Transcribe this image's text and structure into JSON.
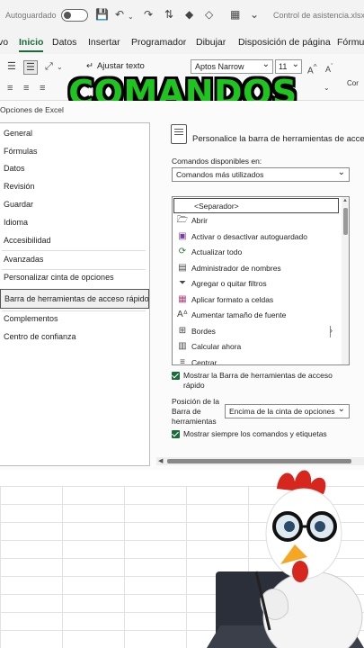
{
  "titlebar": {
    "autosave_label": "Autoguardado",
    "document_title": "Control de asistencia.xlsx"
  },
  "menu": {
    "items": [
      "vo",
      "Inicio",
      "Datos",
      "Insertar",
      "Programador",
      "Dibujar",
      "Disposición de página",
      "Fórmul"
    ],
    "active": "Inicio"
  },
  "ribbon": {
    "wrap_text": "Ajustar texto",
    "font_name": "Aptos Narrow",
    "font_size": "11",
    "side_label": "Cor"
  },
  "overlay_title": "COMANDOS",
  "dialog": {
    "title": "Opciones de Excel",
    "nav": [
      "General",
      "Fórmulas",
      "Datos",
      "Revisión",
      "Guardar",
      "Idioma",
      "Accesibilidad",
      "Avanzadas",
      "Personalizar cinta de opciones",
      "Barra de herramientas de acceso rápido",
      "Complementos",
      "Centro de confianza"
    ],
    "selected_nav": "Barra de herramientas de acceso rápido",
    "heading": "Personalice la barra de herramientas de acceso",
    "commands_from_label": "Comandos disponibles en:",
    "commands_from_value": "Comandos más utilizados",
    "commands": [
      {
        "icon": "separator-icon",
        "label": "<Separador>"
      },
      {
        "icon": "open-folder-icon",
        "label": "Abrir"
      },
      {
        "icon": "autosave-icon",
        "label": "Activar o desactivar autoguardado"
      },
      {
        "icon": "refresh-all-icon",
        "label": "Actualizar todo"
      },
      {
        "icon": "name-manager-icon",
        "label": "Administrador de nombres"
      },
      {
        "icon": "filter-icon",
        "label": "Agregar o quitar filtros"
      },
      {
        "icon": "format-cells-icon",
        "label": "Aplicar formato a celdas"
      },
      {
        "icon": "font-size-up-icon",
        "label": "Aumentar tamaño de fuente"
      },
      {
        "icon": "borders-icon",
        "label": "Bordes"
      },
      {
        "icon": "calculator-icon",
        "label": "Calcular ahora"
      },
      {
        "icon": "center-icon",
        "label": "Centrar"
      }
    ],
    "show_qat_label": "Mostrar la Barra de herramientas de acceso rápido",
    "show_qat_checked": true,
    "position_label": "Posición de la Barra de herramientas",
    "position_value": "Encima de la cinta de opciones",
    "always_show_label": "Mostrar siempre los comandos y etiquetas",
    "always_show_checked": true
  },
  "colors": {
    "accent_green": "#1b6b3a",
    "overlay_green": "#1ec51e"
  }
}
